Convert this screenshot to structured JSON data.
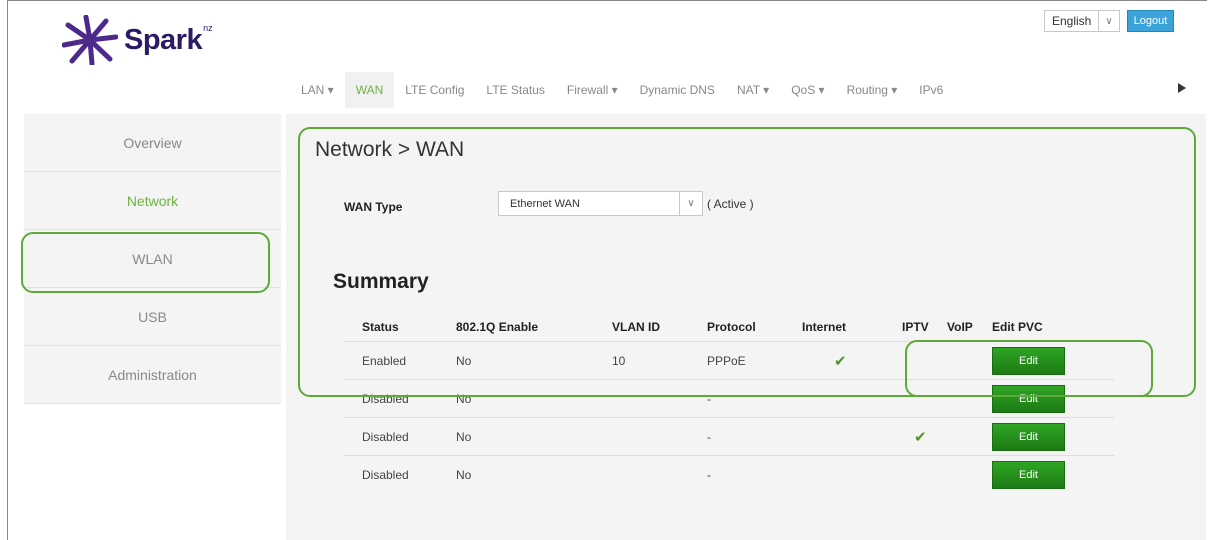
{
  "brand": {
    "name": "Spark",
    "suffix": "nz"
  },
  "header": {
    "language": "English",
    "logout_label": "Logout"
  },
  "topnav": {
    "items": [
      {
        "label": "LAN ▾",
        "active": false
      },
      {
        "label": "WAN",
        "active": true
      },
      {
        "label": "LTE Config",
        "active": false
      },
      {
        "label": "LTE Status",
        "active": false
      },
      {
        "label": "Firewall ▾",
        "active": false
      },
      {
        "label": "Dynamic DNS",
        "active": false
      },
      {
        "label": "NAT ▾",
        "active": false
      },
      {
        "label": "QoS ▾",
        "active": false
      },
      {
        "label": "Routing ▾",
        "active": false
      },
      {
        "label": "IPv6",
        "active": false
      }
    ]
  },
  "sidebar": {
    "items": [
      {
        "label": "Overview",
        "active": false
      },
      {
        "label": "Network",
        "active": true
      },
      {
        "label": "WLAN",
        "active": false
      },
      {
        "label": "USB",
        "active": false
      },
      {
        "label": "Administration",
        "active": false
      }
    ]
  },
  "main": {
    "title": "Network > WAN",
    "wan_type_label": "WAN Type",
    "wan_type_value": "Ethernet WAN",
    "wan_type_state": "( Active )",
    "summary_title": "Summary",
    "table": {
      "headers": [
        "Status",
        "802.1Q Enable",
        "VLAN ID",
        "Protocol",
        "Internet",
        "IPTV",
        "VoIP",
        "Edit PVC"
      ],
      "rows": [
        {
          "status": "Enabled",
          "dot1q": "No",
          "vlan_id": "10",
          "protocol": "PPPoE",
          "internet": true,
          "iptv": false,
          "voip": false,
          "edit": "Edit"
        },
        {
          "status": "Disabled",
          "dot1q": "No",
          "vlan_id": "",
          "protocol": "-",
          "internet": false,
          "iptv": false,
          "voip": false,
          "edit": "Edit"
        },
        {
          "status": "Disabled",
          "dot1q": "No",
          "vlan_id": "",
          "protocol": "-",
          "internet": false,
          "iptv": true,
          "voip": false,
          "edit": "Edit"
        },
        {
          "status": "Disabled",
          "dot1q": "No",
          "vlan_id": "",
          "protocol": "-",
          "internet": false,
          "iptv": false,
          "voip": false,
          "edit": "Edit"
        }
      ]
    }
  },
  "colors": {
    "accent_green": "#6db33f",
    "button_green": "#2a9a1f",
    "logout_blue": "#3aa3d9",
    "brand_purple": "#2b1a66",
    "highlight_outline": "#5fa83a"
  },
  "icons": {
    "check": "✔",
    "dropdown": "∨",
    "next": "play-arrow-icon"
  }
}
